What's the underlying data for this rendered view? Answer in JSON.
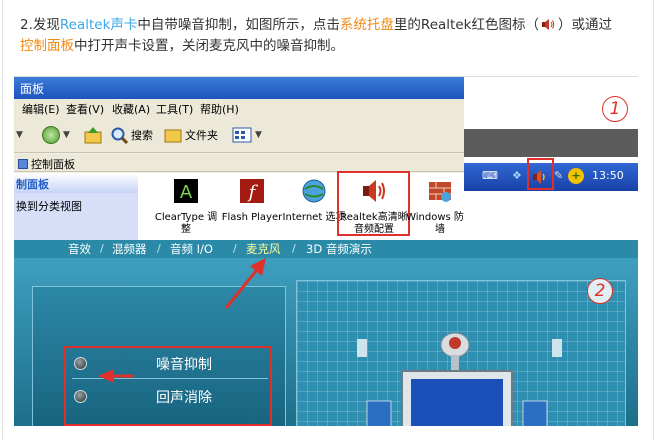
{
  "intro": {
    "part1": "2.发现",
    "link1": "Realtek声卡",
    "part2": "中自带噪音抑制，如图所示，点击",
    "link2": "系统托盘",
    "part3": "里的Realtek红色图标（",
    "part4": "）或通过",
    "link3": "控制面板",
    "part5": "中打开声卡设置，关闭麦克风中的噪音抑制。",
    "icon": "speaker-icon"
  },
  "control_panel": {
    "title": "面板",
    "menu": [
      "编辑(E)",
      "查看(V)",
      "收藏(A)",
      "工具(T)",
      "帮助(H)"
    ],
    "toolbar": {
      "search": "搜索",
      "folders": "文件夹"
    },
    "address": "控制面板",
    "sidebar": {
      "heading": "制面板",
      "link": "换到分类视图"
    },
    "icons": [
      {
        "label": "ClearType 调整",
        "icon": "cleartype-icon"
      },
      {
        "label": "Flash Player",
        "icon": "flash-icon"
      },
      {
        "label": "Internet 选项",
        "icon": "globe-icon"
      },
      {
        "label": "Realtek高清晰音频配置",
        "icon": "realtek-speaker-icon"
      },
      {
        "label": "Windows 防火墙",
        "icon": "firewall-icon"
      }
    ]
  },
  "taskbar": {
    "clock": "13:50"
  },
  "markers": {
    "one": "1",
    "two": "2"
  },
  "realtek": {
    "tabs": [
      "音效",
      "混频器",
      "音频 I/O",
      "麦克风",
      "3D 音频演示"
    ],
    "options": [
      "噪音抑制",
      "回声消除"
    ]
  },
  "colors": {
    "highlight_red": "#e0302b",
    "link_blue": "#3aa7e8",
    "link_orange": "#f08a16"
  }
}
